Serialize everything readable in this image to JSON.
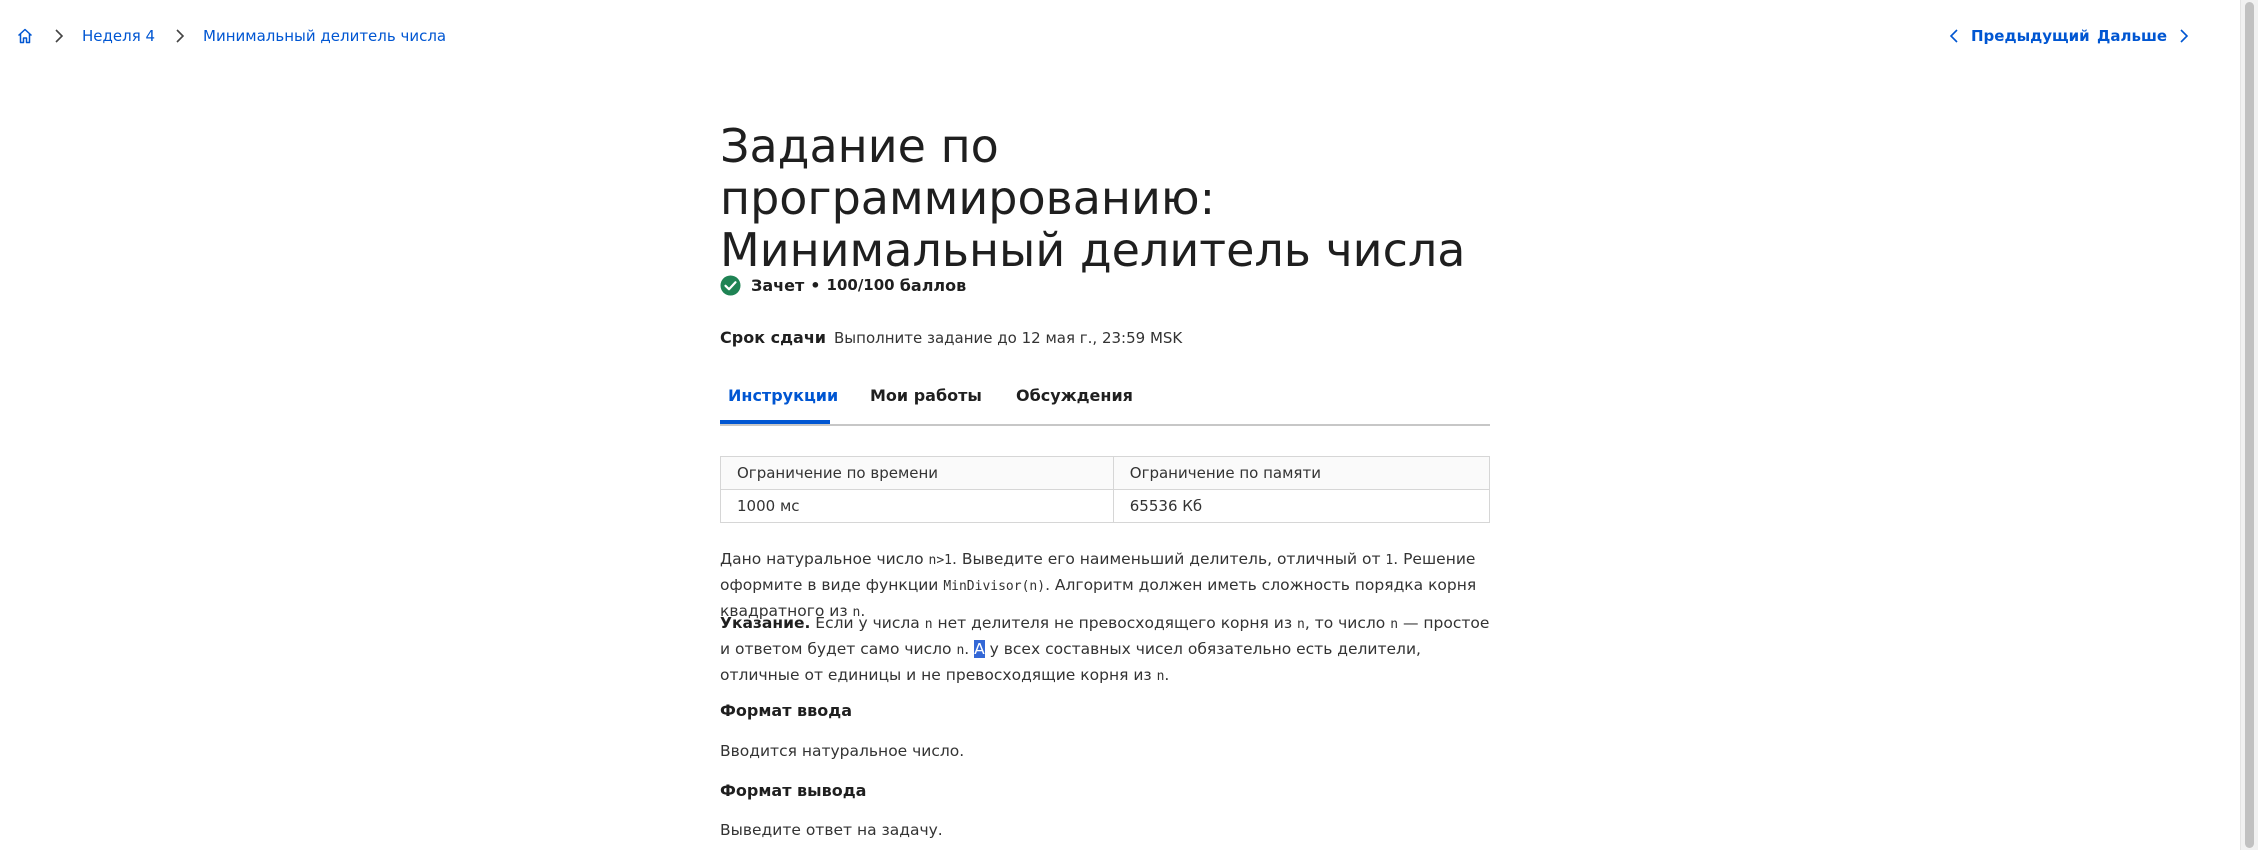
{
  "breadcrumb": {
    "week": "Неделя 4",
    "current": "Минимальный делитель числа"
  },
  "pager": {
    "prev": "Предыдущий",
    "next": "Дальше"
  },
  "title_line1": "Задание по программированию:",
  "title_line2": "Минимальный делитель числа",
  "status": {
    "grade": "Зачет",
    "separator": "•",
    "score": "100/100",
    "score_unit": "баллов"
  },
  "deadline": {
    "label": "Срок сдачи",
    "value": "Выполните задание до 12 мая г., 23:59 MSK"
  },
  "tabs": [
    "Инструкции",
    "Мои работы",
    "Обсуждения"
  ],
  "limits_table": {
    "headers": [
      "Ограничение по времени",
      "Ограничение по памяти"
    ],
    "row": [
      "1000 мс",
      "65536 Кб"
    ]
  },
  "statement": {
    "p1_a": "Дано натуральное число ",
    "p1_n_gt_1": "n>1",
    "p1_b": ". Выведите его наименьший делитель, отличный от ",
    "p1_one": "1",
    "p1_c": ". Решение оформите в виде функции ",
    "p1_func": "MinDivisor(n)",
    "p1_d": ". Алгоритм должен иметь сложность порядка корня квадратного из ",
    "p1_n": "n",
    "p1_e": "."
  },
  "hint": {
    "label": "Указание.",
    "a": " Если у числа ",
    "n1": "n",
    "b": " нет делителя не превосходящего корня из ",
    "n2": "n",
    "c": ", то число ",
    "n3": "n",
    "d": " — простое и ответом будет само число ",
    "n4": "n",
    "e": ". ",
    "selected": "А",
    "f": " у всех составных чисел обязательно есть делители, отличные от единицы и не превосходящие корня из ",
    "n5": "n",
    "g": "."
  },
  "input_format": {
    "heading": "Формат ввода",
    "text": "Вводится натуральное число."
  },
  "output_format": {
    "heading": "Формат вывода",
    "text": "Выведите ответ на задачу."
  },
  "colors": {
    "accent": "#0056d2",
    "success": "#1f8354",
    "text": "#1f1f1f"
  }
}
